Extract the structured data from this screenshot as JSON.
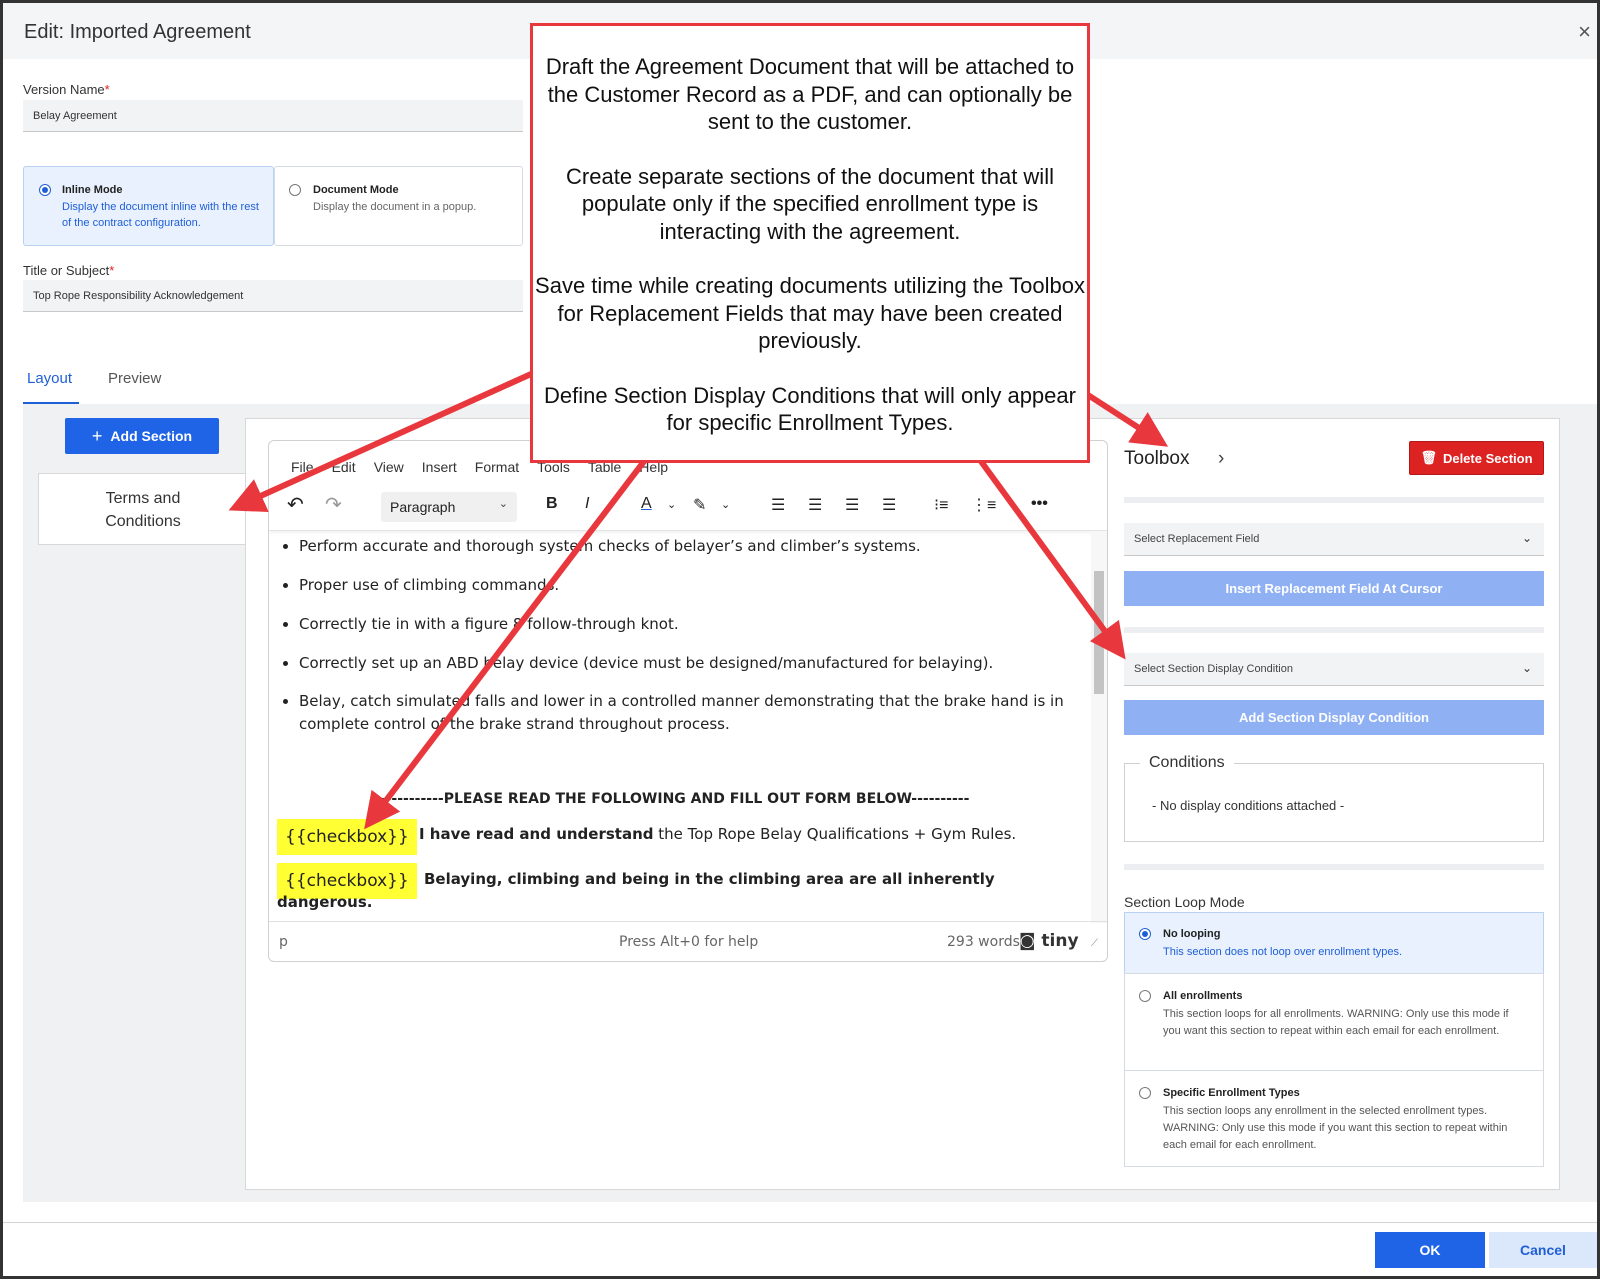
{
  "window": {
    "title": "Edit: Imported Agreement",
    "close_symbol": "×"
  },
  "version_name": {
    "label": "Version Name",
    "required_mark": "*",
    "value": "Belay Agreement"
  },
  "modes": [
    {
      "title": "Inline Mode",
      "desc": "Display the document inline with the rest of the contract configuration.",
      "selected": true
    },
    {
      "title": "Document Mode",
      "desc": "Display the document in a popup.",
      "selected": false
    }
  ],
  "title_subject": {
    "label": "Title or Subject",
    "required_mark": "*",
    "value": "Top Rope Responsibility Acknowledgement"
  },
  "tabs": [
    {
      "label": "Layout",
      "active": true
    },
    {
      "label": "Preview",
      "active": false
    }
  ],
  "add_section_label": "Add Section",
  "add_section_icon": "+",
  "section_card": {
    "line1": "Terms and",
    "line2": "Conditions"
  },
  "editor": {
    "menu": [
      "File",
      "Edit",
      "View",
      "Insert",
      "Format",
      "Tools",
      "Table",
      "Help"
    ],
    "paragraph_select": "Paragraph",
    "bullets": [
      "Perform accurate and thorough system checks of belayer’s and climber’s systems.",
      "Proper use of climbing commands.",
      "Correctly tie in with a figure 8 follow-through knot.",
      "Correctly set up an ABD belay device (device must be designed/manufactured for belaying).",
      "Belay, catch simulated falls and lower in a controlled manner demonstrating that the brake hand is in complete control of the brake strand throughout process."
    ],
    "please_read": "------------PLEASE READ THE FOLLOWING AND FILL OUT FORM BELOW----------",
    "checkbox_token": "{{checkbox}}",
    "checkbox1_bold": "I have read and understand",
    "checkbox1_rest": " the Top Rope Belay Qualifications + Gym Rules.",
    "checkbox2_bold_line1": "Belaying, climbing and being in the climbing area are all inherently",
    "checkbox2_bold_line2": "dangerous.",
    "status_path": "p",
    "status_help": "Press Alt+0 for help",
    "status_words": "293 words",
    "brand": "tiny"
  },
  "toolbox": {
    "title": "Toolbox",
    "delete_label": "Delete Section",
    "replacement_placeholder": "Select Replacement Field",
    "insert_label": "Insert Replacement Field At Cursor",
    "condition_placeholder": "Select Section Display Condition",
    "add_condition_label": "Add Section Display Condition",
    "conditions_legend": "Conditions",
    "conditions_empty": "- No display conditions attached -",
    "loop_label": "Section Loop Mode",
    "loop_options": [
      {
        "title": "No looping",
        "desc": "This section does not loop over enrollment types.",
        "selected": true
      },
      {
        "title": "All enrollments",
        "desc": "This section loops for all enrollments. WARNING: Only use this mode if you want this section to repeat within each email for each enrollment.",
        "selected": false
      },
      {
        "title": "Specific Enrollment Types",
        "desc": "This section loops any enrollment in the selected enrollment types. WARNING: Only use this mode if you want this section to repeat within each email for each enrollment.",
        "selected": false
      }
    ]
  },
  "footer": {
    "ok_label": "OK",
    "cancel_label": "Cancel"
  },
  "callout": [
    "Draft the Agreement Document that will be attached to the Customer Record as a PDF, and can optionally be sent to the customer.",
    "Create separate sections of the document that will populate only if the specified enrollment type is interacting with the agreement.",
    "Save time while creating documents utilizing the Toolbox for Replacement Fields that may have been created previously.",
    "Define Section Display Conditions that will only appear for specific Enrollment Types."
  ],
  "colors": {
    "primary": "#1f63e6",
    "primary_light": "#8fb1f4",
    "danger": "#dd2222",
    "callout_red": "#e8383d",
    "highlight": "#ffff33",
    "selected_bg": "#e8f1fd"
  }
}
